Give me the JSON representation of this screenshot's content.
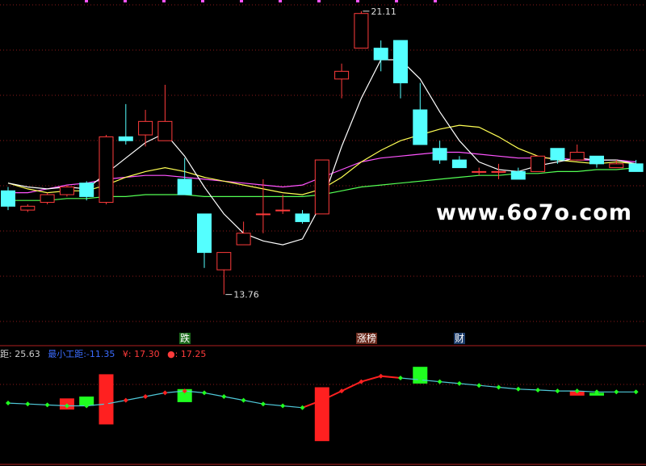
{
  "chart_data": [
    {
      "type": "candlestick",
      "title": "",
      "ylim": [
        12.6,
        21.4
      ],
      "grid": "dotted horizontal lines",
      "candles": [
        {
          "o": 16.45,
          "c": 16.05,
          "h": 16.55,
          "l": 15.95
        },
        {
          "o": 15.95,
          "c": 16.05,
          "h": 16.1,
          "l": 15.9
        },
        {
          "o": 16.15,
          "c": 16.35,
          "h": 16.4,
          "l": 16.1
        },
        {
          "o": 16.35,
          "c": 16.55,
          "h": 16.6,
          "l": 16.3
        },
        {
          "o": 16.65,
          "c": 16.3,
          "h": 16.7,
          "l": 16.2
        },
        {
          "o": 16.15,
          "c": 17.85,
          "h": 17.9,
          "l": 16.1
        },
        {
          "o": 17.85,
          "c": 17.75,
          "h": 18.7,
          "l": 17.65
        },
        {
          "o": 17.9,
          "c": 18.25,
          "h": 18.55,
          "l": 17.6
        },
        {
          "o": 17.75,
          "c": 18.25,
          "h": 19.2,
          "l": 17.75
        },
        {
          "o": 16.75,
          "c": 16.35,
          "h": 17.3,
          "l": 16.35
        },
        {
          "o": 15.85,
          "c": 14.85,
          "h": 15.85,
          "l": 14.45
        },
        {
          "o": 14.4,
          "c": 14.85,
          "h": 14.85,
          "l": 13.76
        },
        {
          "o": 15.05,
          "c": 15.35,
          "h": 15.65,
          "l": 15.05
        },
        {
          "o": 15.85,
          "c": 15.85,
          "h": 16.75,
          "l": 15.35
        },
        {
          "o": 15.95,
          "c": 15.95,
          "h": 16.35,
          "l": 15.85
        },
        {
          "o": 15.85,
          "c": 15.65,
          "h": 15.95,
          "l": 15.6
        },
        {
          "o": 15.85,
          "c": 17.25,
          "h": 17.25,
          "l": 15.85
        },
        {
          "o": 19.35,
          "c": 19.55,
          "h": 19.75,
          "l": 18.85
        },
        {
          "o": 20.15,
          "c": 21.05,
          "h": 21.11,
          "l": 20.15
        },
        {
          "o": 20.15,
          "c": 19.85,
          "h": 20.35,
          "l": 19.55
        },
        {
          "o": 20.35,
          "c": 19.25,
          "h": 20.35,
          "l": 18.85
        },
        {
          "o": 18.55,
          "c": 17.65,
          "h": 19.25,
          "l": 17.65
        },
        {
          "o": 17.55,
          "c": 17.25,
          "h": 17.75,
          "l": 17.15
        },
        {
          "o": 17.25,
          "c": 17.05,
          "h": 17.35,
          "l": 17.05
        },
        {
          "o": 16.95,
          "c": 16.95,
          "h": 17.05,
          "l": 16.85
        },
        {
          "o": 16.95,
          "c": 16.95,
          "h": 17.15,
          "l": 16.75
        },
        {
          "o": 16.95,
          "c": 16.75,
          "h": 17.05,
          "l": 16.75
        },
        {
          "o": 16.95,
          "c": 17.35,
          "h": 17.35,
          "l": 16.95
        },
        {
          "o": 17.55,
          "c": 17.25,
          "h": 17.55,
          "l": 17.15
        },
        {
          "o": 17.25,
          "c": 17.45,
          "h": 17.65,
          "l": 17.25
        },
        {
          "o": 17.35,
          "c": 17.15,
          "h": 17.35,
          "l": 17.05
        },
        {
          "o": 17.05,
          "c": 17.15,
          "h": 17.25,
          "l": 17.05
        },
        {
          "o": 17.15,
          "c": 16.95,
          "h": 17.25,
          "l": 16.95
        }
      ],
      "ma_white": [
        16.65,
        16.55,
        16.5,
        16.55,
        16.5,
        16.9,
        17.3,
        17.7,
        17.95,
        17.35,
        16.55,
        15.85,
        15.35,
        15.15,
        15.05,
        15.2,
        16.15,
        17.6,
        18.85,
        19.85,
        19.85,
        19.35,
        18.5,
        17.75,
        17.2,
        17.0,
        16.95,
        17.1,
        17.2,
        17.3,
        17.25,
        17.25,
        17.15
      ],
      "ma_yellow": [
        16.65,
        16.5,
        16.4,
        16.45,
        16.45,
        16.6,
        16.8,
        16.95,
        17.05,
        16.95,
        16.8,
        16.7,
        16.6,
        16.5,
        16.4,
        16.35,
        16.5,
        16.8,
        17.2,
        17.5,
        17.75,
        17.9,
        18.05,
        18.15,
        18.1,
        17.85,
        17.55,
        17.35,
        17.25,
        17.2,
        17.15,
        17.2,
        17.15
      ],
      "ma_magenta": [
        16.4,
        16.4,
        16.5,
        16.6,
        16.65,
        16.75,
        16.8,
        16.85,
        16.85,
        16.8,
        16.75,
        16.7,
        16.65,
        16.6,
        16.55,
        16.6,
        16.8,
        17.0,
        17.2,
        17.3,
        17.35,
        17.4,
        17.45,
        17.45,
        17.4,
        17.35,
        17.3,
        17.3,
        17.3,
        17.25,
        17.25,
        17.25,
        17.2
      ],
      "ma_green": [
        16.2,
        16.2,
        16.2,
        16.25,
        16.25,
        16.3,
        16.3,
        16.35,
        16.35,
        16.35,
        16.3,
        16.3,
        16.3,
        16.3,
        16.3,
        16.3,
        16.35,
        16.45,
        16.55,
        16.6,
        16.65,
        16.7,
        16.75,
        16.8,
        16.85,
        16.85,
        16.9,
        16.9,
        16.95,
        16.95,
        17.0,
        17.0,
        17.05
      ],
      "annotations": [
        {
          "text": "21.11",
          "candle": 18,
          "value": 21.11,
          "pos": "above"
        },
        {
          "text": "13.76",
          "candle": 11,
          "value": 13.76,
          "pos": "below"
        }
      ],
      "markers": [
        {
          "text": "跌",
          "candle": 9
        },
        {
          "text": "涨榜",
          "candle": 18
        },
        {
          "text": "财",
          "candle": 23
        }
      ]
    },
    {
      "type": "indicator",
      "legend": [
        {
          "text": "距: 25.63"
        },
        {
          "text": "最小工距:-11.35"
        },
        {
          "text": "¥: 17.30"
        },
        {
          "text": "●: 17.25"
        }
      ],
      "ylim": [
        -3,
        2
      ],
      "line": [
        -0.35,
        -0.4,
        -0.45,
        -0.5,
        -0.5,
        -0.4,
        -0.2,
        0.0,
        0.2,
        0.3,
        0.2,
        0.0,
        -0.2,
        -0.4,
        -0.5,
        -0.6,
        -0.2,
        0.3,
        0.8,
        1.1,
        1.0,
        0.9,
        0.8,
        0.7,
        0.6,
        0.5,
        0.4,
        0.35,
        0.3,
        0.3,
        0.25,
        0.25,
        0.25
      ],
      "red_bars": [
        {
          "candle": 3,
          "top": -0.1,
          "bottom": -0.7
        },
        {
          "candle": 5,
          "top": 1.2,
          "bottom": -1.5
        },
        {
          "candle": 16,
          "top": 0.5,
          "bottom": -2.4
        },
        {
          "candle": 29,
          "top": 0.3,
          "bottom": 0.05
        }
      ],
      "green_bars": [
        {
          "candle": 4,
          "top": 0.0,
          "bottom": -0.5
        },
        {
          "candle": 9,
          "top": 0.4,
          "bottom": -0.3
        },
        {
          "candle": 21,
          "top": 1.6,
          "bottom": 0.7
        },
        {
          "candle": 30,
          "top": 0.2,
          "bottom": 0.05
        }
      ]
    }
  ],
  "overlay": {
    "watermark": "www.6o7o.com",
    "tags": {
      "die": "跌",
      "zt": "涨榜",
      "cai": "财"
    },
    "legend": {
      "a": "距: 25.63",
      "b": "最小工距:-11.35",
      "c": "¥: 17.30",
      "d": "●: 17.25"
    }
  },
  "colors": {
    "up": "#ff3b3b",
    "down": "#54ffff",
    "ma_white": "#ffffff",
    "ma_yellow": "#ffff54",
    "ma_magenta": "#ff54ff",
    "ma_green": "#54ff54",
    "grid": "#8b1a1a",
    "ind_line": "#4fc8d8",
    "ind_red": "#ff2020",
    "ind_green": "#20ff20"
  }
}
